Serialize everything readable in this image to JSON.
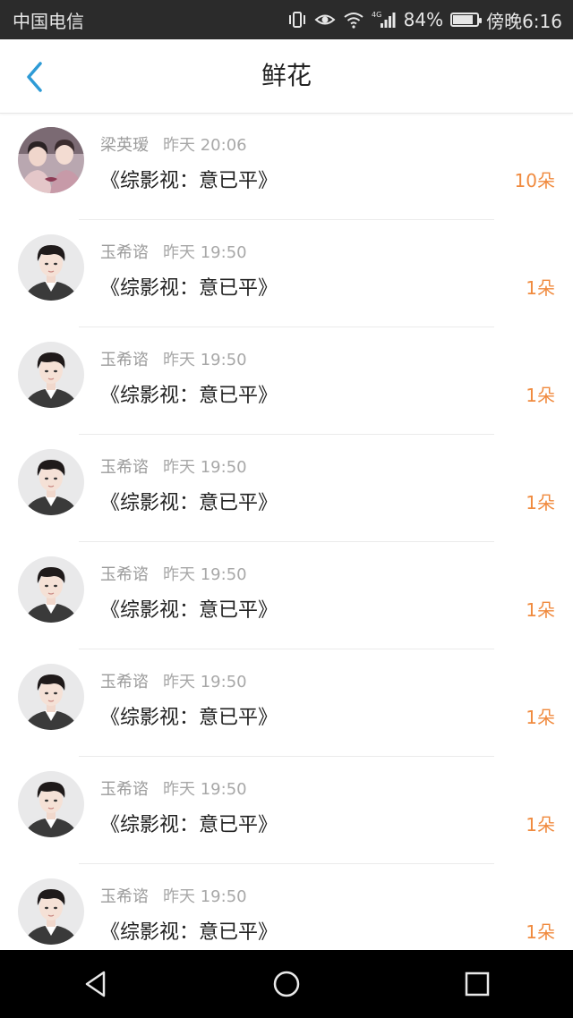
{
  "statusbar": {
    "carrier": "中国电信",
    "battery_percent": "84%",
    "battery_level": 0.84,
    "time": "傍晚6:16",
    "network": "4G",
    "icons": [
      "vibrate-icon",
      "eye-icon",
      "wifi-icon",
      "signal-icon",
      "battery-icon"
    ]
  },
  "header": {
    "title": "鲜花",
    "back_icon": "chevron-left-icon",
    "accent_color": "#2e9bd6"
  },
  "list": {
    "count_color": "#f08a3e",
    "items": [
      {
        "name": "梁英瑷",
        "time": "昨天 20:06",
        "book": "《综影视：意已平》",
        "count": "10朵",
        "avatar": "avatar-couple"
      },
      {
        "name": "玉希谘",
        "time": "昨天 19:50",
        "book": "《综影视：意已平》",
        "count": "1朵",
        "avatar": "avatar-boy"
      },
      {
        "name": "玉希谘",
        "time": "昨天 19:50",
        "book": "《综影视：意已平》",
        "count": "1朵",
        "avatar": "avatar-boy"
      },
      {
        "name": "玉希谘",
        "time": "昨天 19:50",
        "book": "《综影视：意已平》",
        "count": "1朵",
        "avatar": "avatar-boy"
      },
      {
        "name": "玉希谘",
        "time": "昨天 19:50",
        "book": "《综影视：意已平》",
        "count": "1朵",
        "avatar": "avatar-boy"
      },
      {
        "name": "玉希谘",
        "time": "昨天 19:50",
        "book": "《综影视：意已平》",
        "count": "1朵",
        "avatar": "avatar-boy"
      },
      {
        "name": "玉希谘",
        "time": "昨天 19:50",
        "book": "《综影视：意已平》",
        "count": "1朵",
        "avatar": "avatar-boy"
      },
      {
        "name": "玉希谘",
        "time": "昨天 19:50",
        "book": "《综影视：意已平》",
        "count": "1朵",
        "avatar": "avatar-boy"
      }
    ]
  },
  "navbar": {
    "buttons": [
      "back-triangle-icon",
      "home-circle-icon",
      "recents-square-icon"
    ]
  }
}
